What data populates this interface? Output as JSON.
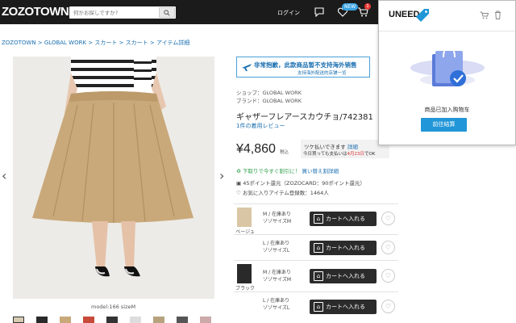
{
  "header": {
    "logo": "ZOZOTOWN",
    "search_placeholder": "何かお探しですか?",
    "login": "ログイン",
    "new_badge": "NEW",
    "cart_count": "1"
  },
  "breadcrumb": "ZOZOTOWN > GLOBAL WORK > スカート > スカート > アイテム詳細",
  "gallery": {
    "caption": "model:166 sizeM",
    "thumb_count": 10
  },
  "notice": {
    "line1": "非常抱歉，此款商品暂不支持海外销售",
    "line2": "支持海外配送的店铺一览"
  },
  "product": {
    "shop": "ショップ：GLOBAL WORK",
    "brand": "ブランド：GLOBAL WORK",
    "title": "ギャザーフレアースカウチョ/742381",
    "review": "1件の着用レビュー",
    "price": "¥4,860",
    "tax": "税込",
    "paylater_text": "ツケ払いできます",
    "paylater_link": "詳細",
    "paylater_sub_prefix": "今日買っても支払いは",
    "paylater_date": "4月23日",
    "paylater_sub_suffix": "でOK",
    "coupon_text": "下取りで今すぐ割引に！",
    "coupon_link": "買い替え割詳細",
    "points": "45ポイント還元（ZOZOCARD：90ポイント還元）",
    "favorites": "お気に入りアイテム登録数：1464人"
  },
  "variants": [
    {
      "color": "ベージュ",
      "size": "M / 在庫あり",
      "size_note": "ゾゾサイズM",
      "button": "カートへ入れる"
    },
    {
      "color": "",
      "size": "L / 在庫あり",
      "size_note": "ゾゾサイズL",
      "button": "カートへ入れる"
    },
    {
      "color": "ブラック",
      "size": "M / 在庫あり",
      "size_note": "ゾゾサイズM",
      "button": "カートへ入れる"
    },
    {
      "color": "",
      "size": "L / 在庫あり",
      "size_note": "ゾゾサイズL",
      "button": "カートへ入れる"
    }
  ],
  "popup": {
    "brand": "UNEED",
    "message": "商品已加入购物车",
    "button": "前往结算"
  },
  "colors": {
    "header_bg": "#1b1b1b",
    "link": "#1a6fb0",
    "accent_blue": "#2196d8",
    "cart_button": "#2b2b2b",
    "coupon_green": "#2c9e4a"
  }
}
